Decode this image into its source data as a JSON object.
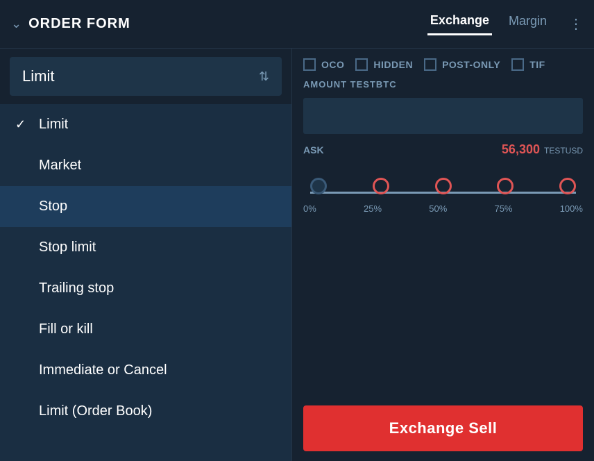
{
  "header": {
    "title": "ORDER FORM",
    "tabs": [
      {
        "label": "Exchange",
        "active": true
      },
      {
        "label": "Margin",
        "active": false
      }
    ],
    "more_label": "⋮"
  },
  "order_form": {
    "selected_type": "Limit",
    "select_arrows": "⇅",
    "dropdown_items": [
      {
        "label": "Limit",
        "selected": true,
        "highlighted": false
      },
      {
        "label": "Market",
        "selected": false,
        "highlighted": false
      },
      {
        "label": "Stop",
        "selected": false,
        "highlighted": true
      },
      {
        "label": "Stop limit",
        "selected": false,
        "highlighted": false
      },
      {
        "label": "Trailing stop",
        "selected": false,
        "highlighted": false
      },
      {
        "label": "Fill or kill",
        "selected": false,
        "highlighted": false
      },
      {
        "label": "Immediate or Cancel",
        "selected": false,
        "highlighted": false
      },
      {
        "label": "Limit (Order Book)",
        "selected": false,
        "highlighted": false
      }
    ],
    "checkboxes": [
      {
        "label": "OCO"
      },
      {
        "label": "HIDDEN"
      },
      {
        "label": "POST-ONLY"
      },
      {
        "label": "TIF"
      }
    ],
    "amount_label": "AMOUNT TESTBTC",
    "ask_label": "ASK",
    "ask_price": "56,300",
    "ask_currency": "TESTUSD",
    "slider": {
      "dots": [
        {
          "label": "0%",
          "active": false
        },
        {
          "label": "25%",
          "active": true
        },
        {
          "label": "50%",
          "active": true
        },
        {
          "label": "75%",
          "active": true
        },
        {
          "label": "100%",
          "active": true
        }
      ]
    },
    "sell_button_label": "Exchange Sell"
  }
}
